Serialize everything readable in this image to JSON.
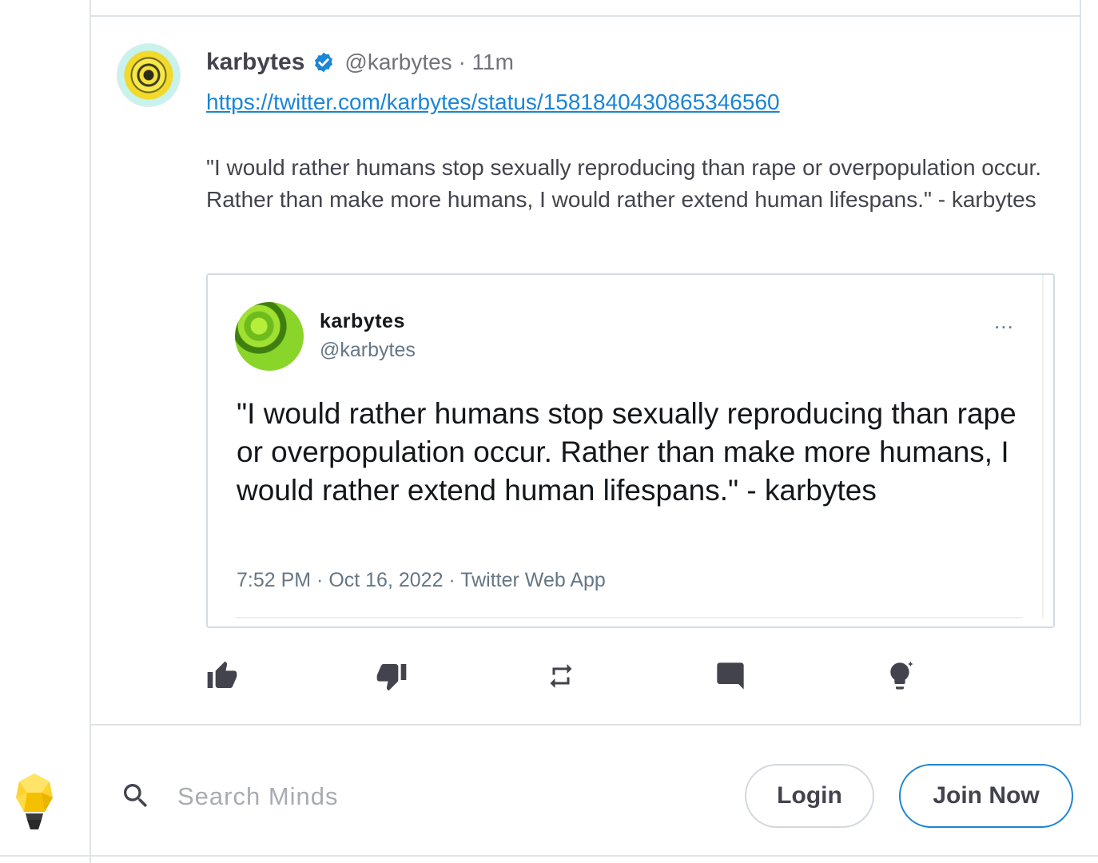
{
  "post": {
    "author_name": "karbytes",
    "handle_time": "@karbytes · 11m",
    "link": "https://twitter.com/karbytes/status/1581840430865346560",
    "text": "\"I would rather humans stop sexually reproducing than rape or overpopulation occur. Rather than make more humans, I would rather extend human lifespans.\" - karbytes"
  },
  "embed": {
    "name": "karbytes",
    "handle": "@karbytes",
    "more": "...",
    "text": "\"I would rather humans stop sexually reproducing than rape or overpopulation occur. Rather than make more humans, I would rather extend human lifespans.\" - karbytes",
    "meta": "7:52 PM · Oct 16, 2022 · Twitter Web App"
  },
  "actions": [
    {
      "icon": "thumbs-up-icon"
    },
    {
      "icon": "thumbs-down-icon"
    },
    {
      "icon": "remind-icon"
    },
    {
      "icon": "comment-icon"
    },
    {
      "icon": "boost-icon"
    }
  ],
  "topbar": {
    "search_placeholder": "Search Minds",
    "login_label": "Login",
    "join_label": "Join Now"
  },
  "colors": {
    "accent": "#1b85d6",
    "text": "#43434d",
    "muted": "#72727c",
    "icon": "#43434d",
    "border": "#dfe3e8"
  }
}
